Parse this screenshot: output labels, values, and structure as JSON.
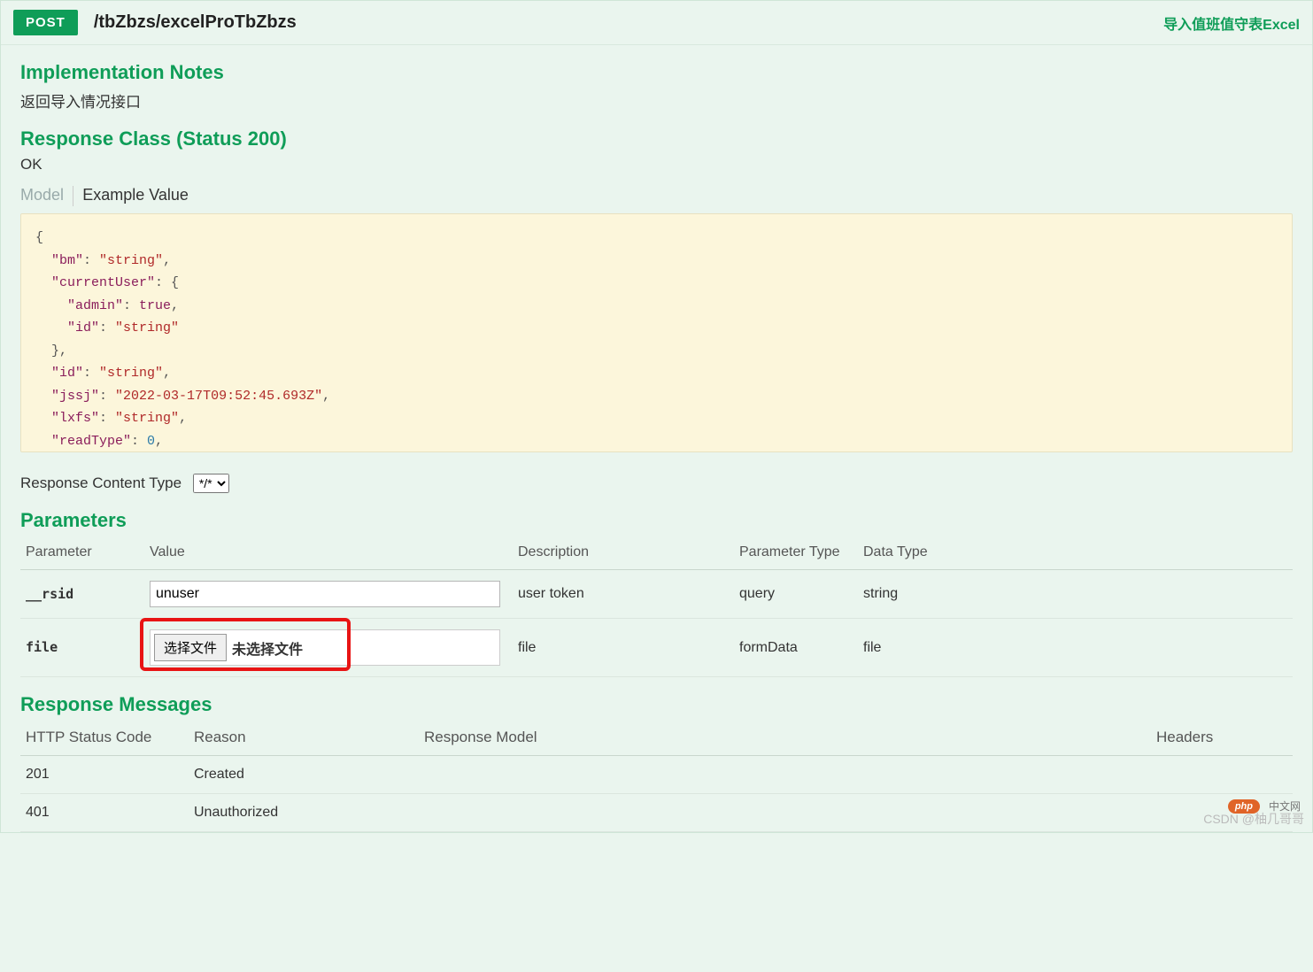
{
  "header": {
    "method": "POST",
    "path": "/tbZbzs/excelProTbZbzs",
    "right_link": "导入值班值守表Excel"
  },
  "sections": {
    "impl_notes_title": "Implementation Notes",
    "impl_notes_text": "返回导入情况接口",
    "response_class_title": "Response Class (Status 200)",
    "response_class_text": "OK",
    "tab_model": "Model",
    "tab_example": "Example Value",
    "rct_label": "Response Content Type",
    "rct_value": "*/*",
    "parameters_title": "Parameters",
    "response_messages_title": "Response Messages"
  },
  "json_example": {
    "bm": "string",
    "currentUser": {
      "admin": true,
      "id": "string"
    },
    "id": "string",
    "jssj": "2022-03-17T09:52:45.693Z",
    "lxfs": "string",
    "readType": 0
  },
  "param_headers": {
    "parameter": "Parameter",
    "value": "Value",
    "description": "Description",
    "ptype": "Parameter Type",
    "dtype": "Data Type"
  },
  "params": [
    {
      "name": "__rsid",
      "value": "unuser",
      "desc": "user token",
      "ptype": "query",
      "dtype": "string",
      "kind": "text"
    },
    {
      "name": "file",
      "file_btn": "选择文件",
      "file_txt": "未选择文件",
      "desc": "file",
      "ptype": "formData",
      "dtype": "file",
      "kind": "file"
    }
  ],
  "resp_headers": {
    "code": "HTTP Status Code",
    "reason": "Reason",
    "model": "Response Model",
    "headers": "Headers"
  },
  "responses": [
    {
      "code": "201",
      "reason": "Created"
    },
    {
      "code": "401",
      "reason": "Unauthorized"
    }
  ],
  "footer": {
    "watermark": "CSDN @柚几哥哥",
    "php_badge": "php",
    "cn_badge": "中文网"
  }
}
